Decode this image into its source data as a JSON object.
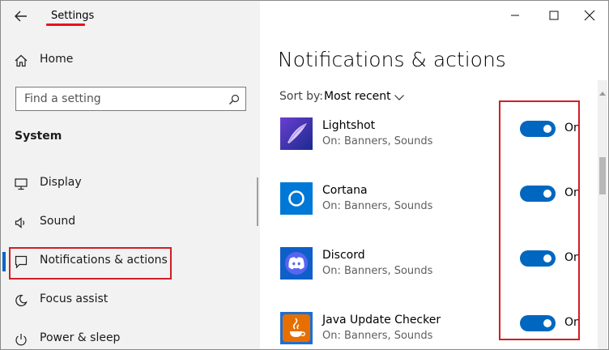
{
  "window": {
    "title": "Settings"
  },
  "sidebar": {
    "home_label": "Home",
    "search_placeholder": "Find a setting",
    "section_heading": "System",
    "items": [
      {
        "label": "Display",
        "icon": "monitor-icon"
      },
      {
        "label": "Sound",
        "icon": "speaker-icon"
      },
      {
        "label": "Notifications & actions",
        "icon": "notification-icon",
        "selected": true
      },
      {
        "label": "Focus assist",
        "icon": "moon-icon"
      },
      {
        "label": "Power & sleep",
        "icon": "power-icon"
      }
    ]
  },
  "main": {
    "title": "Notifications & actions",
    "sort_label": "Sort by:",
    "sort_value": "Most recent",
    "apps": [
      {
        "name": "Lightshot",
        "status": "On: Banners, Sounds",
        "toggle": "On",
        "icon": "lightshot-icon"
      },
      {
        "name": "Cortana",
        "status": "On: Banners, Sounds",
        "toggle": "On",
        "icon": "cortana-icon"
      },
      {
        "name": "Discord",
        "status": "On: Banners, Sounds",
        "toggle": "On",
        "icon": "discord-icon"
      },
      {
        "name": "Java Update Checker",
        "status": "On: Banners, Sounds",
        "toggle": "On",
        "icon": "java-icon"
      }
    ]
  },
  "colors": {
    "accent": "#0067c0",
    "annotation_red": "#d41d25",
    "sidebar_bg": "#f2f2f2"
  }
}
